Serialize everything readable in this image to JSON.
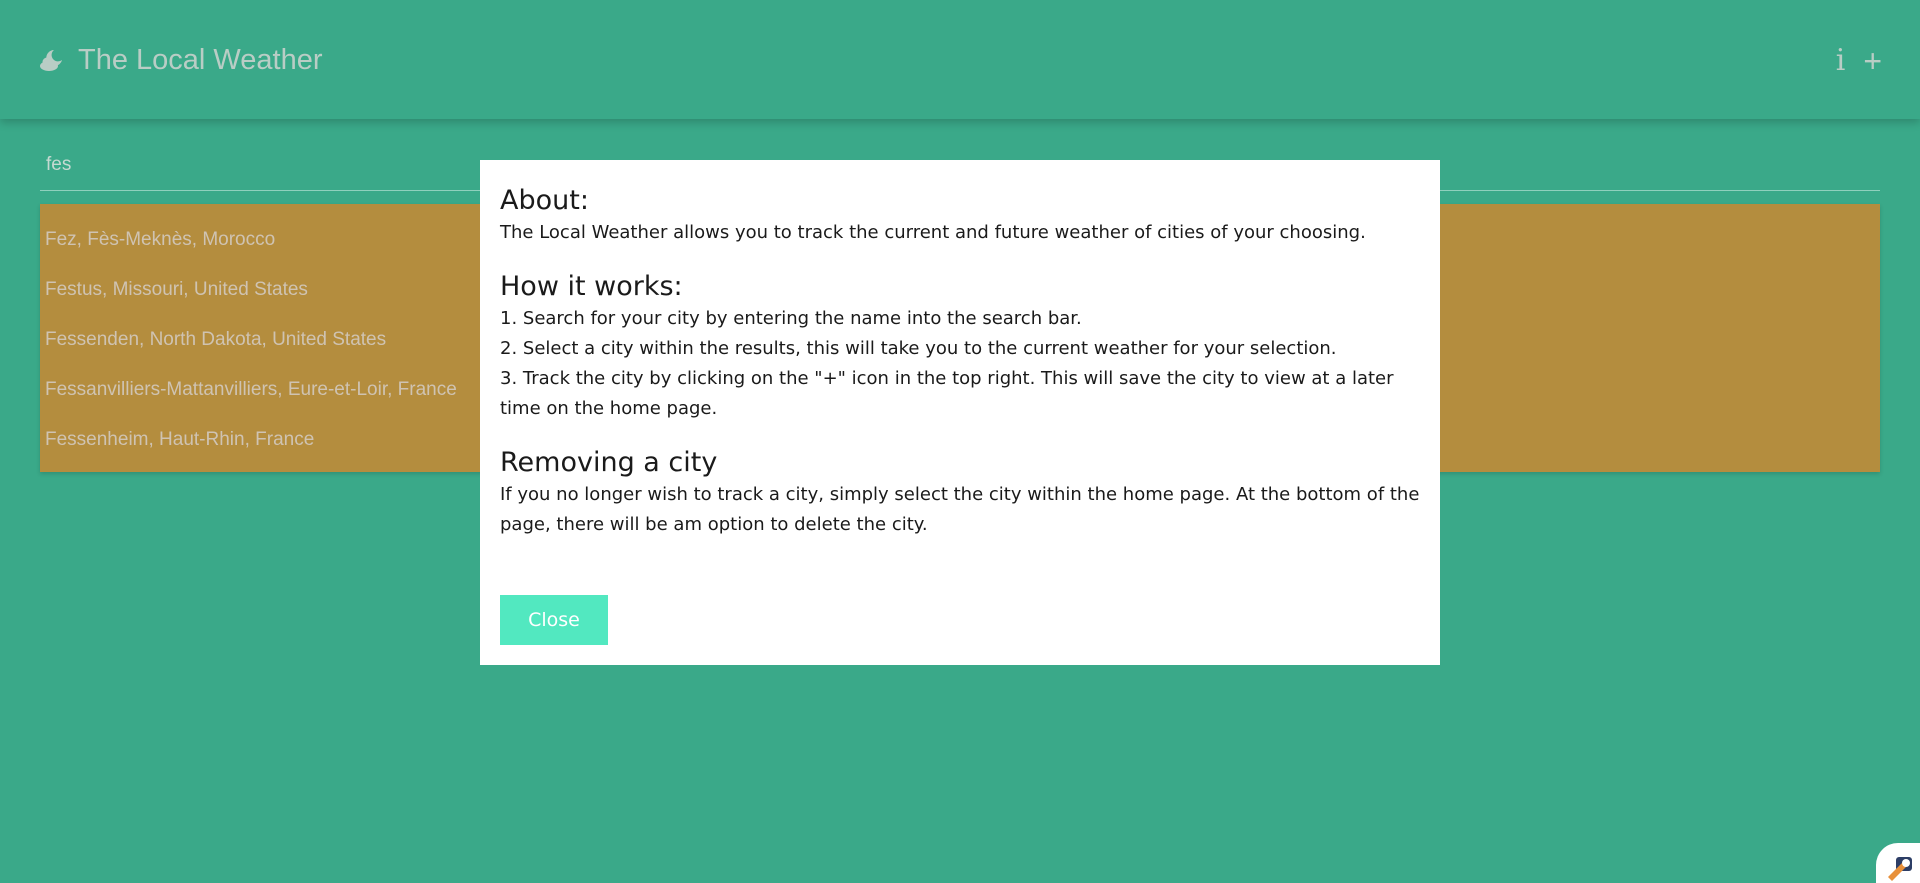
{
  "header": {
    "title": "The Local Weather",
    "logo_icon": "weather-cloud-moon-icon",
    "info_label": "i",
    "add_label": "+"
  },
  "search": {
    "value": "fes"
  },
  "results": [
    "Fez, Fès-Meknès, Morocco",
    "Festus, Missouri, United States",
    "Fessenden, North Dakota, United States",
    "Fessanvilliers-Mattanvilliers, Eure-et-Loir, France",
    "Fessenheim, Haut-Rhin, France"
  ],
  "modal": {
    "about_title": "About:",
    "about_text": "The Local Weather allows you to track the current and future weather of cities of your choosing.",
    "how_title": "How it works:",
    "how_steps": [
      "1. Search for your city by entering the name into the search bar.",
      "2. Select a city within the results, this will take you to the current weather for your selection.",
      "3. Track the city by clicking on the \"+\" icon in the top right. This will save the city to view at a later time on the home page."
    ],
    "remove_title": "Removing a city",
    "remove_text": "If you no longer wish to track a city, simply select the city within the home page. At the bottom of the page, there will be am option to delete the city.",
    "close_label": "Close"
  },
  "colors": {
    "background": "#3aa989",
    "results_background": "#b48d3e",
    "close_button": "#52e8c0",
    "header_text": "#b9cdc5"
  }
}
